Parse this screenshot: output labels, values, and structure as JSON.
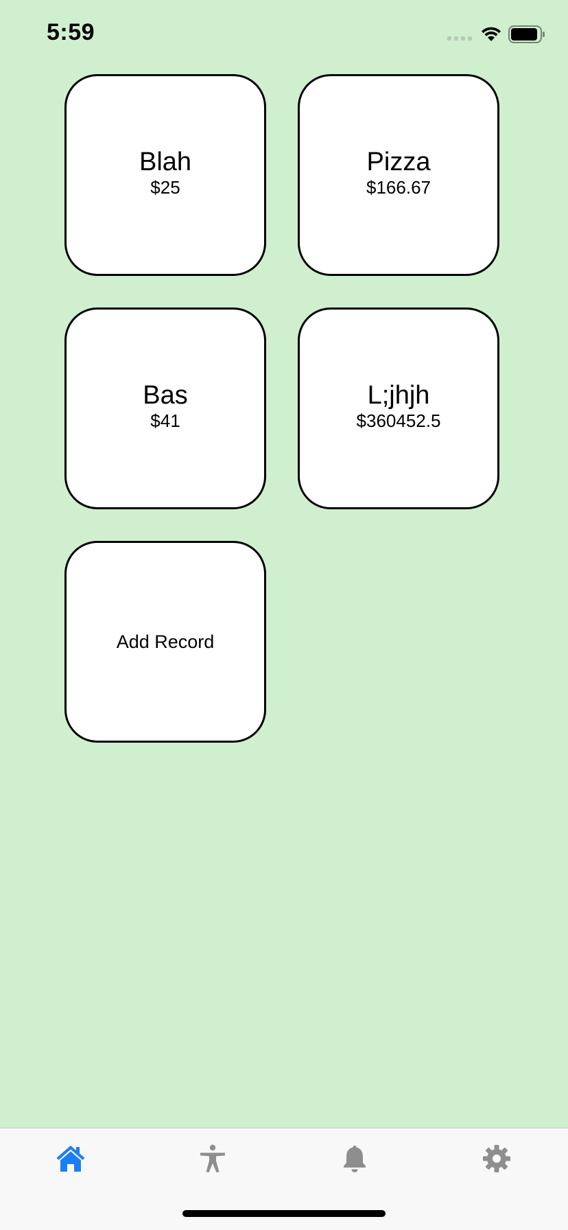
{
  "status_bar": {
    "time": "5:59"
  },
  "records": [
    {
      "name": "Blah",
      "amount": "$25"
    },
    {
      "name": "Pizza",
      "amount": "$166.67"
    },
    {
      "name": "Bas",
      "amount": "$41"
    },
    {
      "name": "L;jhjh",
      "amount": "$360452.5"
    }
  ],
  "add_button": {
    "label": "Add Record"
  },
  "tab_bar": {
    "tabs": [
      {
        "icon": "house-icon",
        "active": true
      },
      {
        "icon": "accessibility-icon",
        "active": false
      },
      {
        "icon": "bell-icon",
        "active": false
      },
      {
        "icon": "gear-icon",
        "active": false
      }
    ]
  },
  "colors": {
    "background": "#d0efcf",
    "card": "#ffffff",
    "active_tab": "#1a7ff5",
    "inactive_tab": "#8e8e8e"
  }
}
